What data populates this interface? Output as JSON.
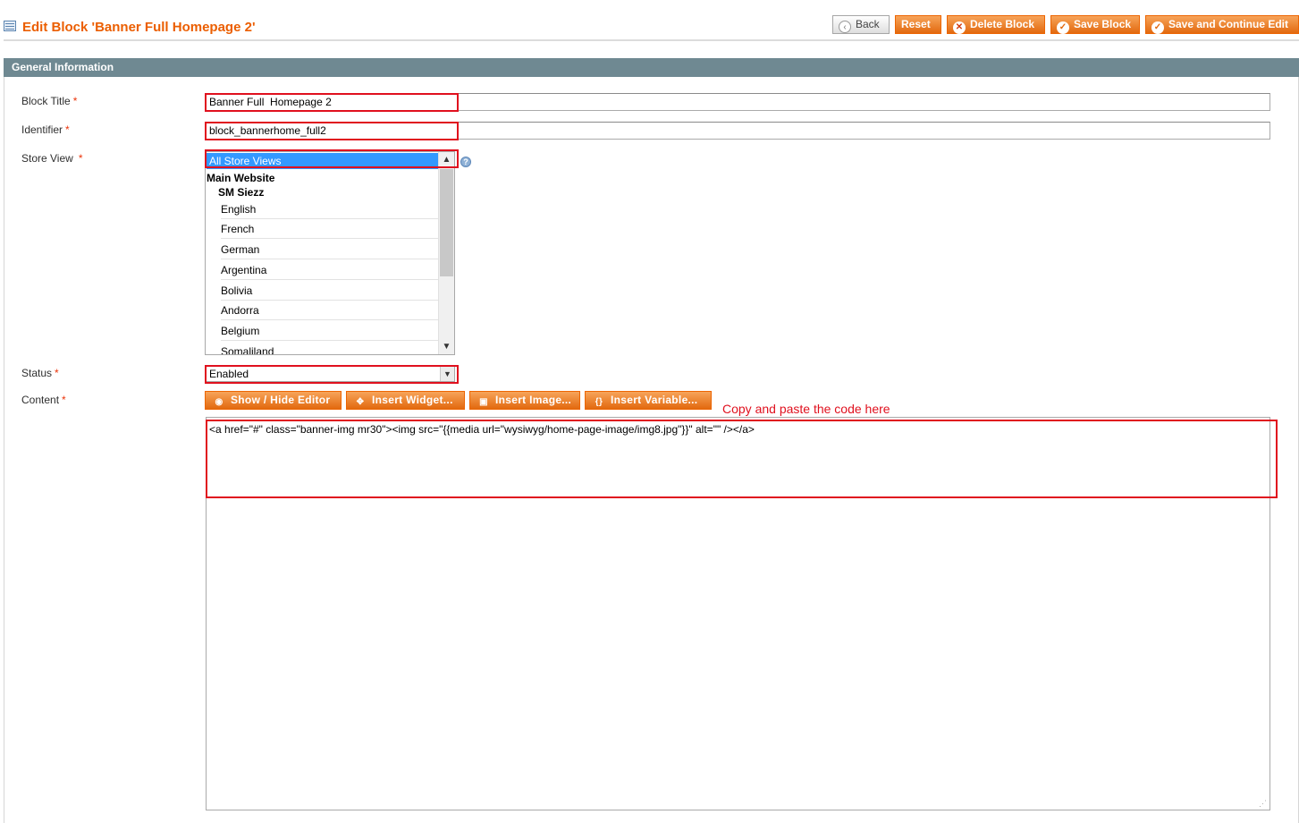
{
  "header": {
    "title": "Edit Block 'Banner Full Homepage 2'",
    "buttons": {
      "back": "Back",
      "reset": "Reset",
      "delete": "Delete Block",
      "save": "Save Block",
      "save_continue": "Save and Continue Edit"
    }
  },
  "section": {
    "title": "General Information"
  },
  "form": {
    "block_title": {
      "label": "Block Title",
      "value": "Banner Full  Homepage 2"
    },
    "identifier": {
      "label": "Identifier",
      "value": "block_bannerhome_full2"
    },
    "store_view": {
      "label": "Store View",
      "selected": "All Store Views",
      "website": "Main Website",
      "store": "SM Siezz",
      "options": [
        "English",
        "French",
        "German",
        "Argentina",
        "Bolivia",
        "Andorra",
        "Belgium",
        "Somaliland"
      ]
    },
    "status": {
      "label": "Status",
      "value": "Enabled"
    },
    "content": {
      "label": "Content",
      "value": "<a href=\"#\" class=\"banner-img mr30\"><img src=\"{{media url=\"wysiwyg/home-page-image/img8.jpg\"}}\" alt=\"\" /></a>"
    },
    "required_mark": "*"
  },
  "editor_buttons": {
    "show_hide": "Show / Hide Editor",
    "widget": "Insert Widget...",
    "image": "Insert Image...",
    "variable": "Insert Variable..."
  },
  "annotation": "Copy and paste the code here",
  "colors": {
    "accent": "#eb5e00",
    "highlight": "#e0101e",
    "section_header": "#6f8992"
  }
}
